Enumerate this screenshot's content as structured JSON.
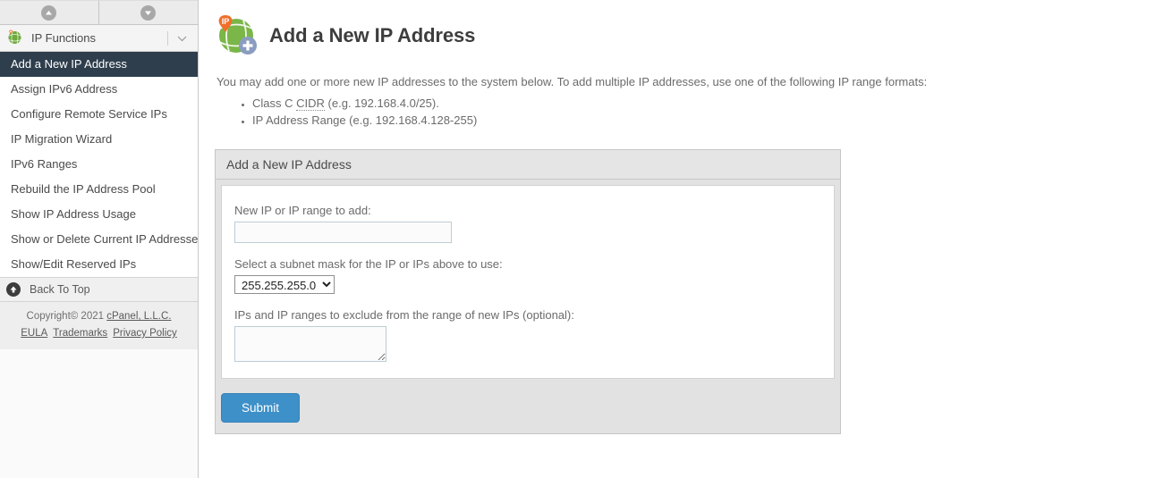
{
  "sidebar": {
    "nav": {
      "up_icon": "chevron-up-circle-icon",
      "down_icon": "chevron-down-circle-icon"
    },
    "group": {
      "icon": "globe-ip-icon",
      "title": "IP Functions",
      "collapse_icon": "chevron-down-icon"
    },
    "items": [
      {
        "label": "Add a New IP Address",
        "active": true
      },
      {
        "label": "Assign IPv6 Address",
        "active": false
      },
      {
        "label": "Configure Remote Service IPs",
        "active": false
      },
      {
        "label": "IP Migration Wizard",
        "active": false
      },
      {
        "label": "IPv6 Ranges",
        "active": false
      },
      {
        "label": "Rebuild the IP Address Pool",
        "active": false
      },
      {
        "label": "Show IP Address Usage",
        "active": false
      },
      {
        "label": "Show or Delete Current IP Addresses",
        "active": false
      },
      {
        "label": "Show/Edit Reserved IPs",
        "active": false
      }
    ],
    "back_to_top": {
      "label": "Back To Top",
      "icon": "arrow-up-circle-icon"
    },
    "footer": {
      "copyright_prefix": "Copyright© 2021 ",
      "company": "cPanel, L.L.C.",
      "links": [
        "EULA",
        "Trademarks",
        "Privacy Policy"
      ]
    }
  },
  "header": {
    "icon": "globe-ip-plus-icon",
    "title": "Add a New IP Address"
  },
  "main": {
    "intro": "You may add one or more new IP addresses to the system below. To add multiple IP addresses, use one of the following IP range formats:",
    "formats": [
      {
        "prefix": "Class C ",
        "abbr": "CIDR",
        "suffix": " (e.g. 192.168.4.0/25)."
      },
      {
        "prefix": "IP Address Range (e.g. 192.168.4.128-255)",
        "abbr": "",
        "suffix": ""
      }
    ]
  },
  "form": {
    "panel_title": "Add a New IP Address",
    "new_ip_label": "New IP or IP range to add:",
    "new_ip_value": "",
    "new_ip_placeholder": "",
    "subnet_label": "Select a subnet mask for the IP or IPs above to use:",
    "subnet_selected": "255.255.255.0",
    "subnet_options": [
      "255.255.255.0"
    ],
    "exclude_label": "IPs and IP ranges to exclude from the range of new IPs (optional):",
    "exclude_value": "",
    "submit_label": "Submit"
  },
  "colors": {
    "active_nav": "#2f3e4d",
    "submit_blue": "#3d90c8",
    "globe_green": "#7ab648",
    "pin_orange": "#ef6f2b"
  }
}
